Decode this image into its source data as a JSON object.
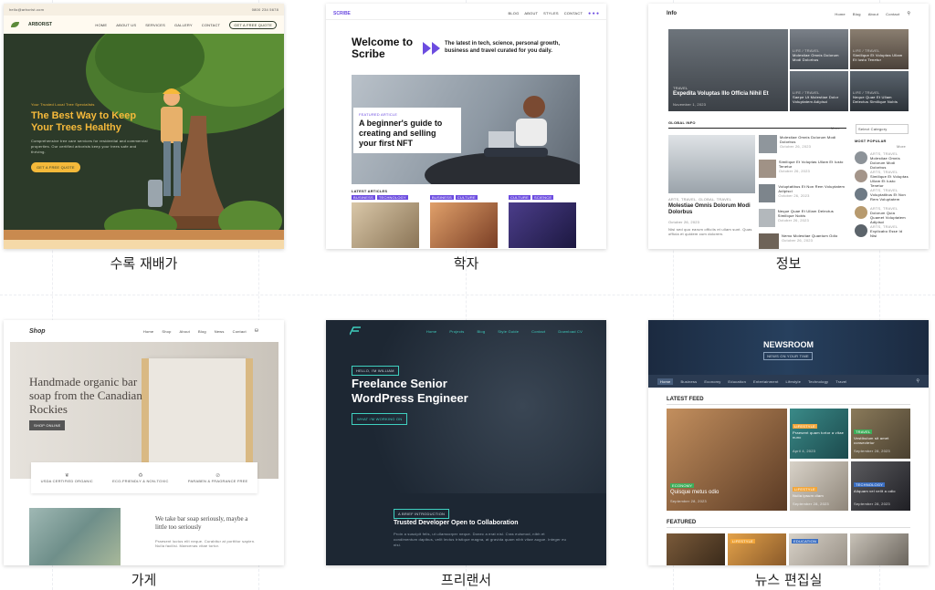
{
  "colors": {
    "tree_bg": "#2c3a29",
    "tree_accent": "#f5b93a",
    "scribe_accent": "#6c4ce0",
    "freelancer_bg": "#1d2733",
    "freelancer_accent": "#3fd0c0",
    "newsroom_bg": "#1f3048"
  },
  "cards": [
    {
      "caption": "수록 재배가",
      "topbar_email": "hello@arborist.com",
      "topbar_phone": "0800 234 5678",
      "logo": "ARBORIST",
      "nav": [
        "HOME",
        "ABOUT US",
        "SERVICES",
        "GALLERY",
        "CONTACT"
      ],
      "cta": "GET A FREE QUOTE",
      "kicker": "Your Trusted Local Tree Specialists",
      "headline": "The Best Way to Keep Your Trees Healthy",
      "body": "Comprehensive tree care services for residential and commercial properties. Our certified arborists keep your trees safe and thriving.",
      "button": "GET A FREE QUOTE"
    },
    {
      "caption": "학자",
      "logo": "SCRIBE",
      "nav": [
        "BLOG",
        "ABOUT",
        "STYLES",
        "CONTACT"
      ],
      "hero_title": "Welcome to Scribe",
      "hero_tagline": "The latest in tech, science, personal growth, business and travel curated for you daily.",
      "featured_kicker": "FEATURED ARTICLE",
      "featured_title": "A beginner's guide to creating and selling your first NFT",
      "latest_label": "LATEST ARTICLES",
      "tags": [
        [
          "BUSINESS",
          "TECHNOLOGY"
        ],
        [
          "BUSINESS",
          "CULTURE"
        ],
        [
          "CULTURE",
          "SCIENCE"
        ]
      ]
    },
    {
      "caption": "정보",
      "logo": "Info",
      "nav": [
        "Home",
        "Blog",
        "About",
        "Contact"
      ],
      "hero_main_tag": "TRAVEL",
      "hero_main_title": "Expedita Voluptas Illo Officia Nihil Et",
      "hero_main_meta": "November 1, 2023",
      "side_items": [
        {
          "tag": "LIFE / TRAVEL",
          "title": "Molestiae Omnis Dolorum Modi Dolorbus"
        },
        {
          "tag": "LIFE / TRAVEL",
          "title": "Similique Et Voluptas Ullam Et Iusto Tenetur"
        },
        {
          "tag": "LIFE / TRAVEL",
          "title": "Saepe Ut Molestiae Dolor Voluptatem Adipisci"
        },
        {
          "tag": "LIFE / TRAVEL",
          "title": "Neque Quae Et Ullam Delectus Similique Nobis"
        }
      ],
      "global_label": "GLOBAL INFO",
      "global_more": "More",
      "select_category": "Select Category",
      "popular_label": "MOST POPULAR",
      "popular_more": "More",
      "feature_tag": "ARTS, TRAVEL, GLOBAL, TRAVEL",
      "feature_title": "Molestiae Omnis Dolorum Modi Dolorbus",
      "feature_date": "October 26, 2023",
      "feature_body": "Nisi sed quo earum officiis et ullam sunt. Quas officia et quidem cum dolorem.",
      "list_items": [
        {
          "title": "Molestiae Omnis Dolorum Modi Dolorbus",
          "date": "October 26, 2023"
        },
        {
          "title": "Similique Et Voluptas Ullam Et Iusto Tenetur",
          "date": "October 26, 2023"
        },
        {
          "title": "Voluptatibus Et Non Rem Voluptatem Adipisci",
          "date": "October 26, 2023"
        },
        {
          "title": "Neque Quae Et Ullam Delectus Similique Nobis",
          "date": "October 26, 2023"
        },
        {
          "title": "Nemo Molestiae Quantum Odio",
          "date": "October 26, 2023"
        }
      ],
      "popular_items": [
        {
          "tag": "ARTS, TRAVEL",
          "title": "Molestiae Omnis Dolorum Modi Dolorbus"
        },
        {
          "tag": "ARTS, TRAVEL",
          "title": "Similique Et Voluptas Ullam Et Iusto Tenetur"
        },
        {
          "tag": "ARTS, TRAVEL",
          "title": "Voluptatibus Et Non Rem Voluptatem"
        },
        {
          "tag": "ARTS, TRAVEL",
          "title": "Dolorum Quia Quamet Voluptatem Adipisci"
        },
        {
          "tag": "ARTS, TRAVEL",
          "title": "Explicabo Esse Id Nisi"
        }
      ]
    },
    {
      "caption": "가게",
      "logo": "Shop",
      "nav": [
        "Home",
        "Shop",
        "About",
        "Blog",
        "News",
        "Contact"
      ],
      "hero_title": "Handmade organic bar soap from the Canadian Rockies",
      "hero_button": "SHOP ONLINE",
      "features": [
        "USDA CERTIFIED ORGANIC",
        "ECO-FRIENDLY & NON-TOXIC",
        "PARABEN & FRAGRANCE FREE"
      ],
      "promo_title": "We take bar soap seriously, maybe a little too seriously",
      "promo_body": "Praesent luctus elit neque. Curabitur at porttitor sapien. Nulla facilisi. Maecenas vitae tortor."
    },
    {
      "caption": "프리랜서",
      "nav": [
        "Home",
        "Projects",
        "Blog",
        "Style Guide",
        "Contact",
        "Download CV"
      ],
      "kicker": "HELLO, I'M WILLIAM",
      "headline": "Freelance Senior WordPress Engineer",
      "button": "WHAT I'M WORKING ON",
      "intro_kicker": "A BRIEF INTRODUCTION",
      "intro_title": "Trusted Developer Open to Collaboration",
      "intro_body": "Proin a suscipit felis, ut ullamcorper neque. Donec a erat nisl. Cras euismod, nibh et condimentum dapibus, velit lectus tristique magna, at gravida quam nibh vitae augue. Integer eu nisi."
    },
    {
      "caption": "뉴스 편집실",
      "logo": "NEWSROOM",
      "tagline": "NEWS ON YOUR TIME",
      "nav": [
        "Home",
        "Business",
        "Economy",
        "Education",
        "Entertainment",
        "Lifestyle",
        "Technology",
        "Travel"
      ],
      "latest_label": "LATEST FEED",
      "main_tag": "ECONOMY",
      "main_title": "Quisque metus odio",
      "main_date": "September 28, 2023",
      "grid": [
        {
          "tag": "LIFESTYLE",
          "title": "Praesent quam tortor a vitae nunc",
          "date": "April 4, 2023"
        },
        {
          "tag": "TRAVEL",
          "title": "Vestibulum sit amet consectetur",
          "date": "September 28, 2023"
        },
        {
          "tag": "LIFESTYLE",
          "title": "Nulla ipsum diam",
          "date": "September 28, 2023"
        },
        {
          "tag": "TECHNOLOGY",
          "title": "Aliquam vel velit a odio",
          "date": "September 28, 2023"
        }
      ],
      "featured_label": "FEATURED",
      "featured_tags": [
        "LIFESTYLE",
        "EDUCATION"
      ]
    }
  ]
}
